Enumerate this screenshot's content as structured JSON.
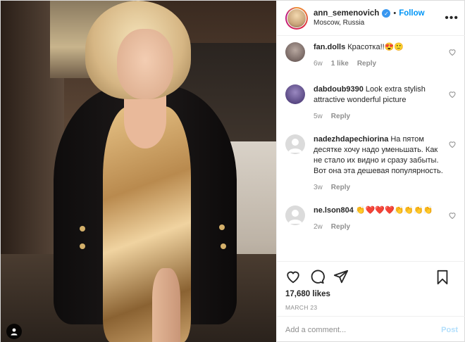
{
  "header": {
    "username": "ann_semenovich",
    "follow_label": "Follow",
    "separator": "•",
    "location": "Moscow, Russia",
    "more_label": "•••"
  },
  "comments": [
    {
      "username": "fan.dolls",
      "text": "Красотка!!😍🙂",
      "time": "6w",
      "likes": "1 like",
      "reply": "Reply",
      "avatar_color": "#8a7a7a"
    },
    {
      "username": "dabdoub9390",
      "text": "Look extra stylish attractive wonderful picture",
      "time": "5w",
      "reply": "Reply",
      "avatar_color": "#5a4a8a"
    },
    {
      "username": "nadezhdapechiorina",
      "text": "На пятом десятке хочу надо уменьшать. Как не стало их видно и сразу забыты. Вот она эта дешевая популярность.",
      "time": "3w",
      "reply": "Reply",
      "avatar_color": "#dbdbdb"
    },
    {
      "username": "ne.lson804",
      "text": "👏❤️❤️❤️👏👏👏👏",
      "time": "2w",
      "reply": "Reply",
      "avatar_color": "#dbdbdb"
    }
  ],
  "likes": "17,680 likes",
  "date": "MARCH 23",
  "add_comment": {
    "placeholder": "Add a comment...",
    "post_label": "Post"
  },
  "colors": {
    "accent": "#0095f6",
    "verified": "#3897f0",
    "muted": "#8e8e8e",
    "post_disabled": "#b2dffc"
  }
}
